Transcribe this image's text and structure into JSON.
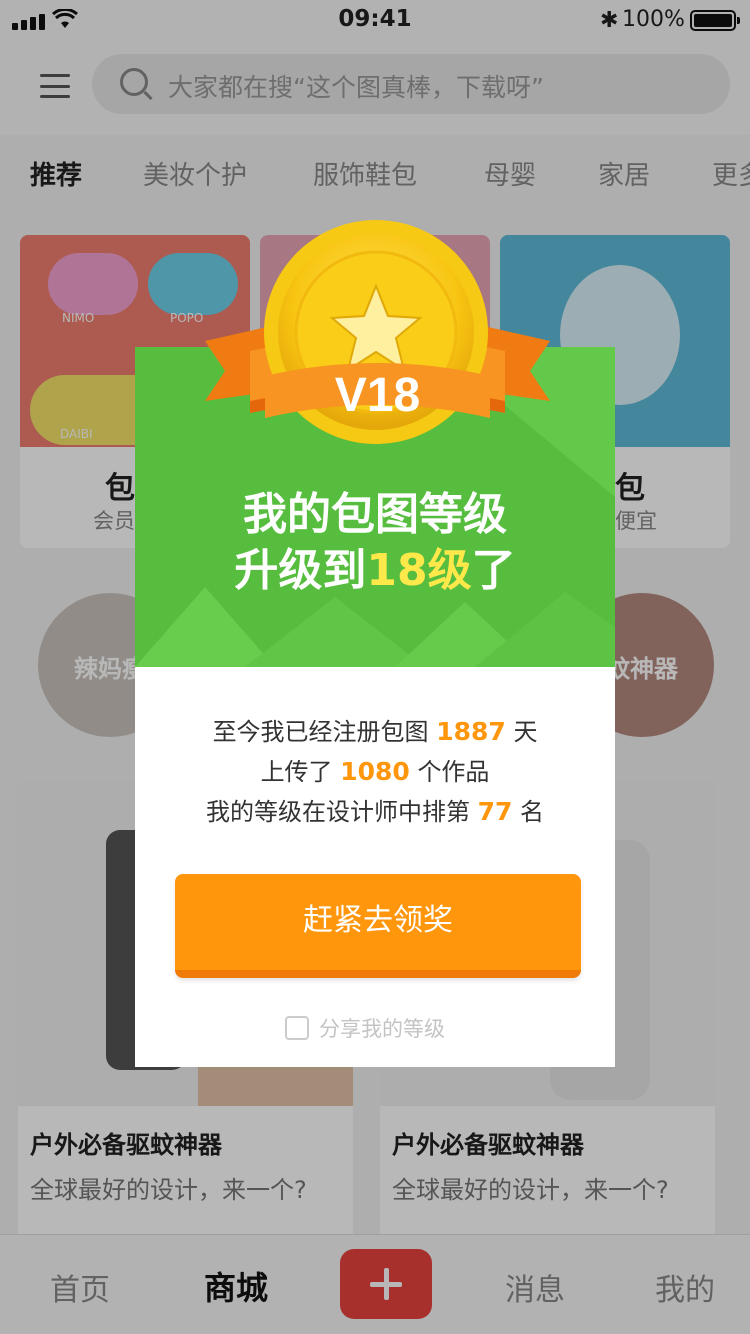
{
  "status_bar": {
    "time": "09:41",
    "battery": "100%"
  },
  "search": {
    "placeholder": "大家都在搜“这个图真棒，下载呀”"
  },
  "category_tabs": [
    "推荐",
    "美妆个护",
    "服饰鞋包",
    "母婴",
    "家居",
    "更多"
  ],
  "promo_cards": [
    {
      "title": "包小",
      "subtitle": "会员半价"
    },
    {
      "title": "",
      "subtitle": ""
    },
    {
      "title": "小包",
      "subtitle": "那俩便宜"
    }
  ],
  "promo_card_product_labels": [
    "NIMO",
    "POPO",
    "DAIBI"
  ],
  "circles": [
    "辣妈瘦",
    "蚊神器"
  ],
  "products": [
    {
      "title": "户外必备驱蚊神器",
      "desc": "全球最好的设计，来一个?"
    },
    {
      "title": "户外必备驱蚊神器",
      "desc": "全球最好的设计，来一个?"
    }
  ],
  "tabbar": {
    "home": "首页",
    "mall": "商城",
    "messages": "消息",
    "mine": "我的"
  },
  "modal": {
    "level_badge": "V18",
    "title_line1": "我的包图等级",
    "title_line2_prefix": "升级到",
    "title_line2_highlight": "18级",
    "title_line2_suffix": "了",
    "registered_prefix": "至今我已经注册包图",
    "registered_days": "1887",
    "registered_suffix": "天",
    "uploads_prefix": "上传了",
    "uploads_count": "1080",
    "uploads_suffix": "个作品",
    "rank_prefix": "我的等级在设计师中排第",
    "rank": "77",
    "rank_suffix": "名",
    "claim_button": "赶紧去领奖",
    "share_label": "分享我的等级"
  },
  "colors": {
    "header_green": "#57bd3f",
    "accent_orange": "#ff960c",
    "highlight_yellow": "#ffe84a",
    "plus_red": "#e8433e"
  }
}
